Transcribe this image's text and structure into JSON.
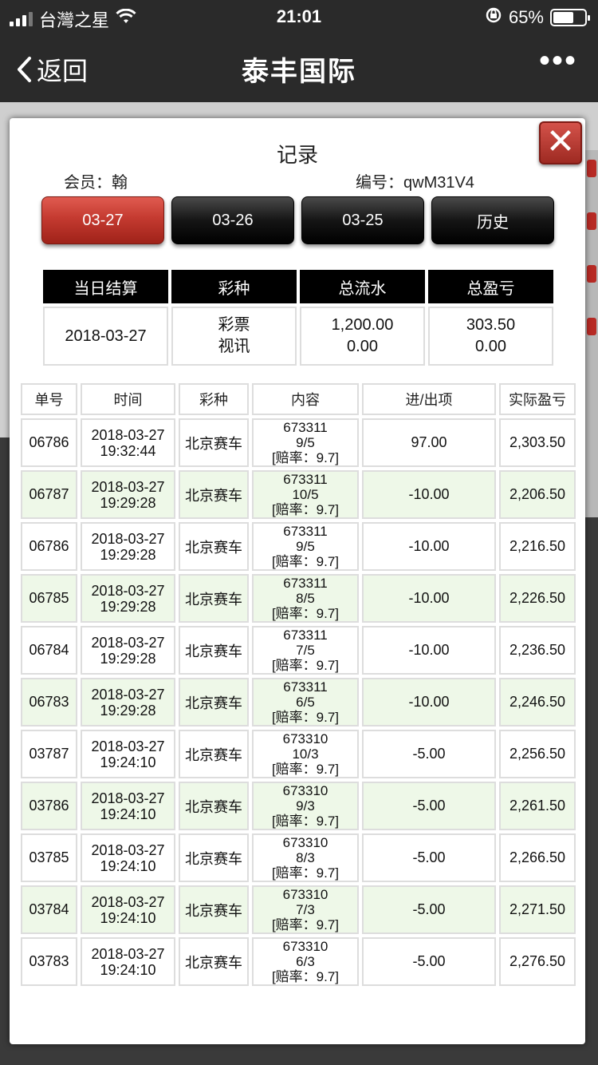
{
  "status_bar": {
    "carrier": "台灣之星",
    "time": "21:01",
    "battery_percent": "65%",
    "battery_level": 0.65
  },
  "nav": {
    "back_label": "返回",
    "title": "泰丰国际",
    "more": "•••"
  },
  "modal": {
    "title": "记录",
    "close_label": "✕",
    "member_label": "会员：翰",
    "serial_label": "编号：qwM31V4",
    "tabs": [
      {
        "label": "03-27",
        "active": true
      },
      {
        "label": "03-26",
        "active": false
      },
      {
        "label": "03-25",
        "active": false
      },
      {
        "label": "历史",
        "active": false
      }
    ],
    "summary": {
      "headers": [
        "当日结算",
        "彩种",
        "总流水",
        "总盈亏"
      ],
      "date": "2018-03-27",
      "lottery_line1": "彩票",
      "lottery_line2": "视讯",
      "turnover_line1": "1,200.00",
      "turnover_line2": "0.00",
      "profit_line1": "303.50",
      "profit_line2": "0.00"
    },
    "records": {
      "headers": [
        "单号",
        "时间",
        "彩种",
        "内容",
        "进/出项",
        "实际盈亏"
      ],
      "rows": [
        {
          "no": "06786",
          "date": "2018-03-27",
          "time": "19:32:44",
          "lottery": "北京赛车",
          "issue": "673311",
          "pick": "9/5",
          "odds": "[赔率：9.7]",
          "io": "97.00",
          "negative": false,
          "pl": "2,303.50"
        },
        {
          "no": "06787",
          "date": "2018-03-27",
          "time": "19:29:28",
          "lottery": "北京赛车",
          "issue": "673311",
          "pick": "10/5",
          "odds": "[赔率：9.7]",
          "io": "-10.00",
          "negative": true,
          "pl": "2,206.50"
        },
        {
          "no": "06786",
          "date": "2018-03-27",
          "time": "19:29:28",
          "lottery": "北京赛车",
          "issue": "673311",
          "pick": "9/5",
          "odds": "[赔率：9.7]",
          "io": "-10.00",
          "negative": true,
          "pl": "2,216.50"
        },
        {
          "no": "06785",
          "date": "2018-03-27",
          "time": "19:29:28",
          "lottery": "北京赛车",
          "issue": "673311",
          "pick": "8/5",
          "odds": "[赔率：9.7]",
          "io": "-10.00",
          "negative": true,
          "pl": "2,226.50"
        },
        {
          "no": "06784",
          "date": "2018-03-27",
          "time": "19:29:28",
          "lottery": "北京赛车",
          "issue": "673311",
          "pick": "7/5",
          "odds": "[赔率：9.7]",
          "io": "-10.00",
          "negative": true,
          "pl": "2,236.50"
        },
        {
          "no": "06783",
          "date": "2018-03-27",
          "time": "19:29:28",
          "lottery": "北京赛车",
          "issue": "673311",
          "pick": "6/5",
          "odds": "[赔率：9.7]",
          "io": "-10.00",
          "negative": true,
          "pl": "2,246.50"
        },
        {
          "no": "03787",
          "date": "2018-03-27",
          "time": "19:24:10",
          "lottery": "北京赛车",
          "issue": "673310",
          "pick": "10/3",
          "odds": "[赔率：9.7]",
          "io": "-5.00",
          "negative": true,
          "pl": "2,256.50"
        },
        {
          "no": "03786",
          "date": "2018-03-27",
          "time": "19:24:10",
          "lottery": "北京赛车",
          "issue": "673310",
          "pick": "9/3",
          "odds": "[赔率：9.7]",
          "io": "-5.00",
          "negative": true,
          "pl": "2,261.50"
        },
        {
          "no": "03785",
          "date": "2018-03-27",
          "time": "19:24:10",
          "lottery": "北京赛车",
          "issue": "673310",
          "pick": "8/3",
          "odds": "[赔率：9.7]",
          "io": "-5.00",
          "negative": true,
          "pl": "2,266.50"
        },
        {
          "no": "03784",
          "date": "2018-03-27",
          "time": "19:24:10",
          "lottery": "北京赛车",
          "issue": "673310",
          "pick": "7/3",
          "odds": "[赔率：9.7]",
          "io": "-5.00",
          "negative": true,
          "pl": "2,271.50"
        },
        {
          "no": "03783",
          "date": "2018-03-27",
          "time": "19:24:10",
          "lottery": "北京赛车",
          "issue": "673310",
          "pick": "6/3",
          "odds": "[赔率：9.7]",
          "io": "-5.00",
          "negative": true,
          "pl": "2,276.50"
        }
      ]
    }
  },
  "colors": {
    "accent_red": "#c43a30",
    "negative_text": "#e22a1e",
    "alt_row_bg": "#eef8e8"
  }
}
